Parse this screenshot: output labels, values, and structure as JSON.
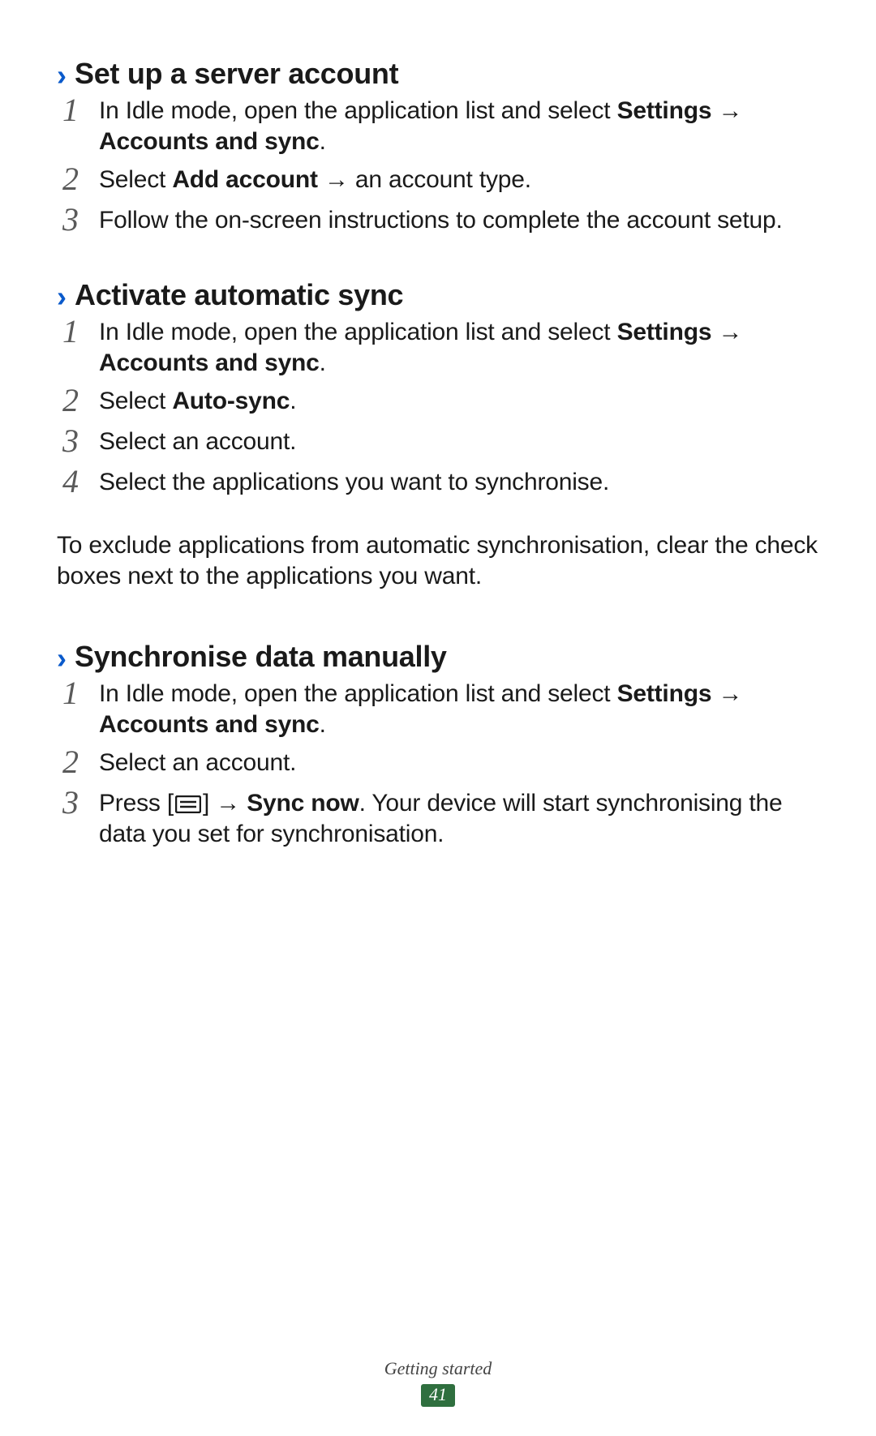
{
  "sections": [
    {
      "title": "Set up a server account",
      "steps": [
        {
          "num": "1",
          "parts": [
            {
              "t": "In Idle mode, open the application list and select "
            },
            {
              "t": "Settings",
              "b": true
            },
            {
              "t": " "
            },
            {
              "t": "→ ",
              "arrow": true,
              "b": true
            },
            {
              "t": "Accounts and sync",
              "b": true
            },
            {
              "t": "."
            }
          ]
        },
        {
          "num": "2",
          "parts": [
            {
              "t": "Select "
            },
            {
              "t": "Add account",
              "b": true
            },
            {
              "t": " "
            },
            {
              "t": "→",
              "arrow": true
            },
            {
              "t": " an account type."
            }
          ]
        },
        {
          "num": "3",
          "parts": [
            {
              "t": "Follow the on-screen instructions to complete the account setup."
            }
          ]
        }
      ]
    },
    {
      "title": "Activate automatic sync",
      "steps": [
        {
          "num": "1",
          "parts": [
            {
              "t": "In Idle mode, open the application list and select "
            },
            {
              "t": "Settings",
              "b": true
            },
            {
              "t": " "
            },
            {
              "t": "→ ",
              "arrow": true,
              "b": true
            },
            {
              "t": "Accounts and sync",
              "b": true
            },
            {
              "t": "."
            }
          ]
        },
        {
          "num": "2",
          "parts": [
            {
              "t": "Select "
            },
            {
              "t": "Auto-sync",
              "b": true
            },
            {
              "t": "."
            }
          ]
        },
        {
          "num": "3",
          "parts": [
            {
              "t": "Select an account."
            }
          ]
        },
        {
          "num": "4",
          "parts": [
            {
              "t": "Select the applications you want to synchronise."
            }
          ]
        }
      ],
      "after_para": "To exclude applications from automatic synchronisation, clear the check boxes next to the applications you want."
    },
    {
      "title": "Synchronise data manually",
      "steps": [
        {
          "num": "1",
          "parts": [
            {
              "t": "In Idle mode, open the application list and select "
            },
            {
              "t": "Settings",
              "b": true
            },
            {
              "t": " "
            },
            {
              "t": "→ ",
              "arrow": true,
              "b": true
            },
            {
              "t": "Accounts and sync",
              "b": true
            },
            {
              "t": "."
            }
          ]
        },
        {
          "num": "2",
          "parts": [
            {
              "t": "Select an account."
            }
          ]
        },
        {
          "num": "3",
          "parts": [
            {
              "t": "Press ["
            },
            {
              "icon": "menu"
            },
            {
              "t": "] "
            },
            {
              "t": "→",
              "arrow": true
            },
            {
              "t": " "
            },
            {
              "t": "Sync now",
              "b": true
            },
            {
              "t": ". Your device will start synchronising the data you set for synchronisation."
            }
          ]
        }
      ]
    }
  ],
  "footer": {
    "label": "Getting started",
    "page": "41"
  },
  "chevron": "›"
}
